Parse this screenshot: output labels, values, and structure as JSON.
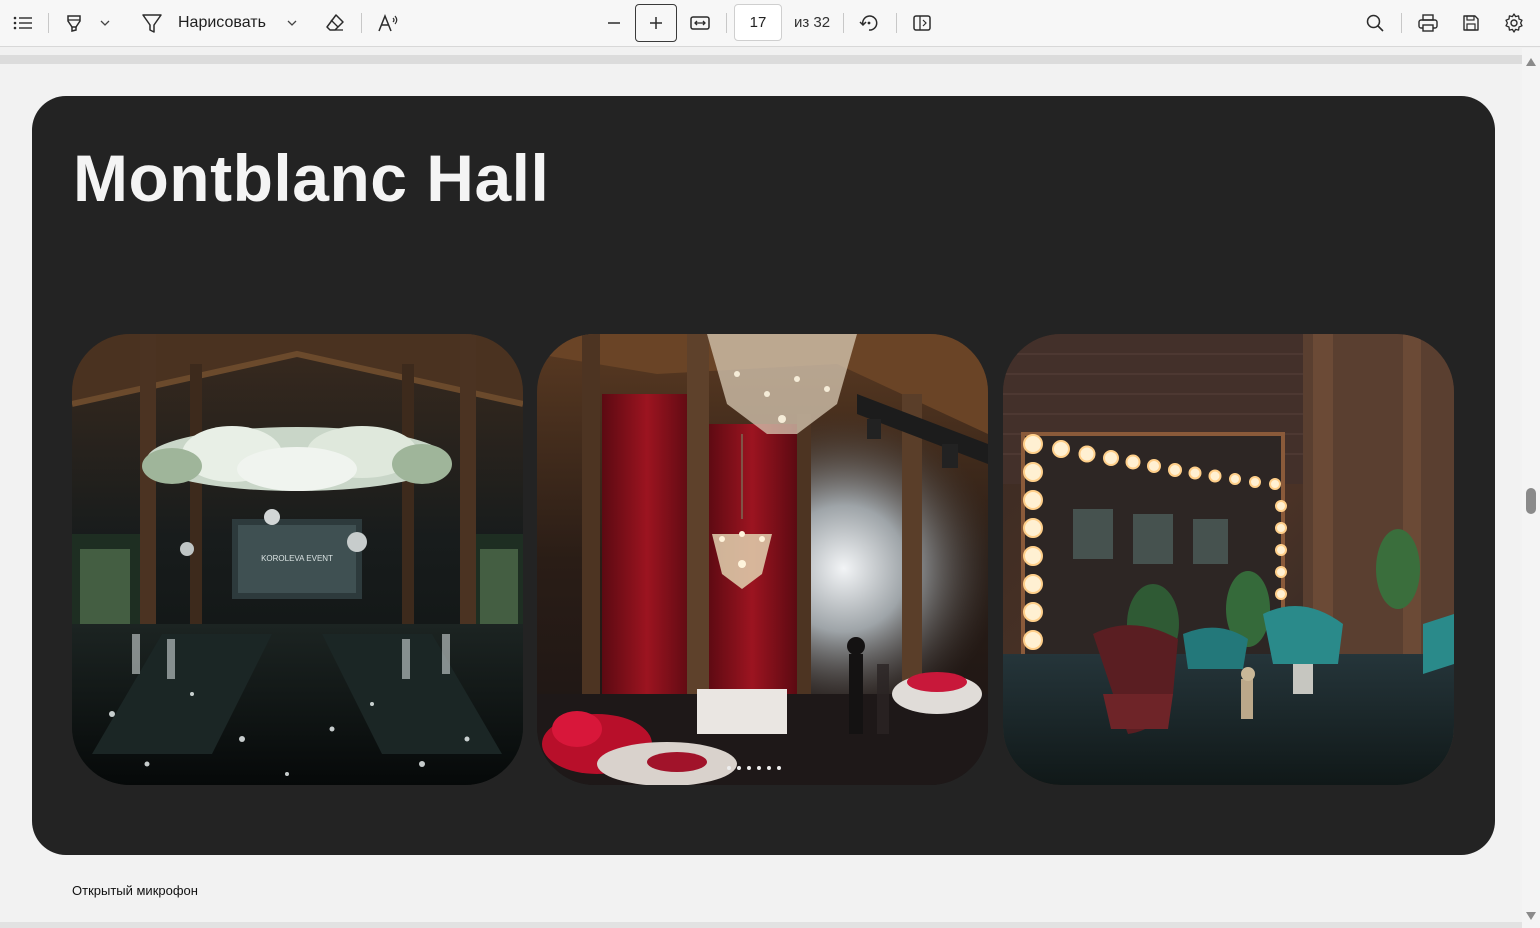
{
  "toolbar": {
    "draw_label": "Нарисовать",
    "page_current": "17",
    "page_total_label": "из 32"
  },
  "slide": {
    "title": "Montblanc Hall",
    "photo_1_screen_text": "KOROLEVA EVENT"
  },
  "notes": {
    "text": "Открытый микрофон"
  },
  "colors": {
    "slide_bg": "#232323",
    "page_bg": "#f2f2f2",
    "toolbar_bg": "#f7f7f7"
  },
  "icons": [
    "contents-icon",
    "highlight-icon",
    "chevron-down-icon",
    "draw-icon",
    "eraser-icon",
    "read-aloud-icon",
    "zoom-out-icon",
    "zoom-in-icon",
    "fit-width-icon",
    "rotate-icon",
    "two-page-icon",
    "search-icon",
    "print-icon",
    "save-icon",
    "settings-icon"
  ]
}
